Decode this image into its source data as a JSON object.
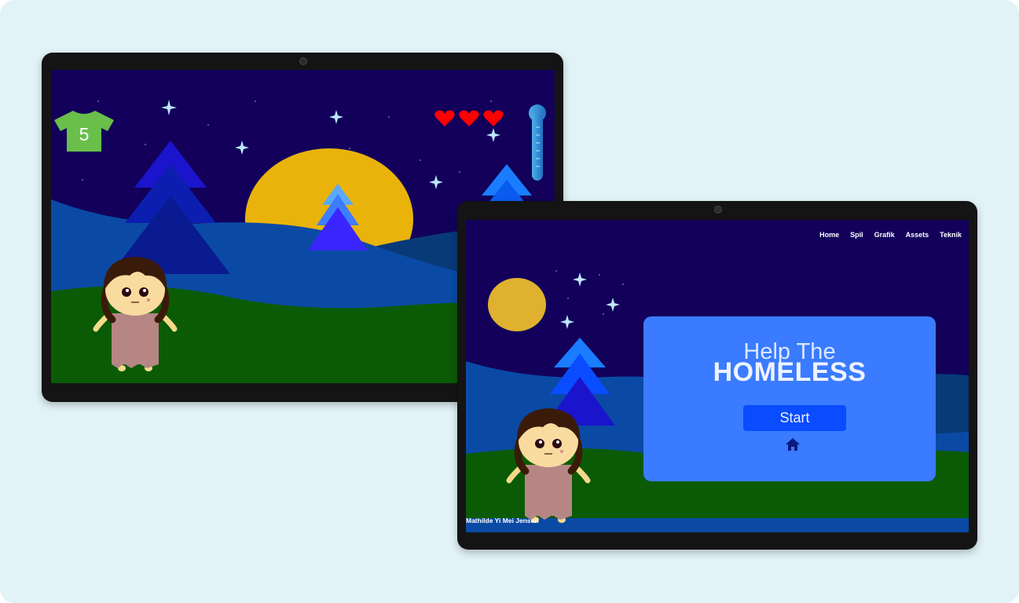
{
  "game": {
    "clothes_count": "5",
    "lives": 3,
    "thermometer_level": 0.5
  },
  "nav": {
    "items": [
      "Home",
      "Spil",
      "Grafik",
      "Assets",
      "Teknik"
    ]
  },
  "menu": {
    "title_line1": "Help The",
    "title_line2": "HOMELESS",
    "start_label": "Start"
  },
  "footer": {
    "author": "Mathilde Yi Mei Jensen"
  },
  "icons": {
    "shirt": "shirt-icon",
    "heart": "heart-icon",
    "thermometer": "thermometer-icon",
    "home": "home-icon",
    "star": "star-icon"
  },
  "colors": {
    "sky": "#12005a",
    "moon": "#eab30b",
    "grass": "#0b5b06",
    "hill_mid": "#0a4aa5",
    "card": "#3a7bff",
    "start_button": "#0a4cff",
    "shirt": "#6abf4b",
    "heart": "#ff0000"
  }
}
